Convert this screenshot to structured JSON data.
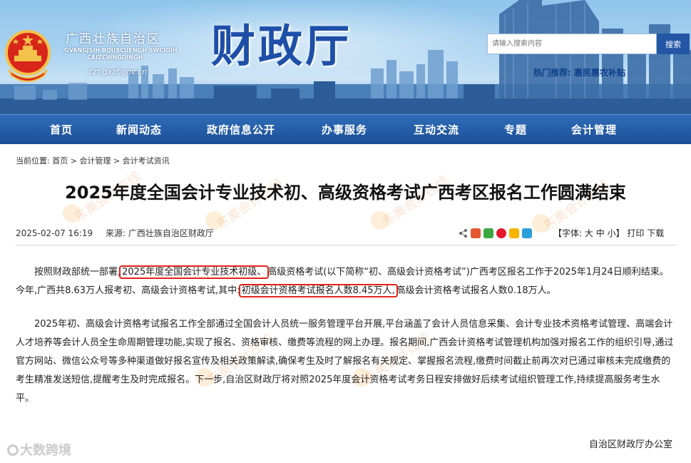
{
  "header": {
    "province_cn": "广西壮族自治区",
    "province_za": [
      "GVANGJSIH BOUXCUENGH SWCIGIH",
      "CAIZCWNGDINGH"
    ],
    "domain": "czt.gxzf.gov.cn",
    "title": "财政厅",
    "search": {
      "placeholder": "请输入搜索内容",
      "button": "搜索"
    },
    "hot": {
      "label": "热门推荐:",
      "item": "惠民惠农补贴"
    }
  },
  "nav": [
    "首页",
    "新闻动态",
    "政府信息公开",
    "办事服务",
    "互动交流",
    "专题",
    "会计管理"
  ],
  "breadcrumb": {
    "prefix": "当前位置:",
    "items": [
      "首页",
      "会计管理",
      "会计考试资讯"
    ],
    "sep": ">"
  },
  "article": {
    "title": "2025年度全国会计专业技术初、高级资格考试广西考区报名工作圆满结束",
    "date": "2025-02-07 16:19",
    "source": "来源: 广西壮族自治区财政厅",
    "options": {
      "font_label": "【字体:",
      "sizes": [
        "大",
        "中",
        "小"
      ],
      "close": "】",
      "print": "打印",
      "download": "下载"
    },
    "p1": {
      "a": "按照财政部统一部署,",
      "h1": "2025年度全国会计专业技术初级、",
      "b": "高级资格考试(以下简称“初、高级会计资格考试”)广西考区报名工作于2025年1月24日顺利结束。今年,广西共8.63万人报考初、高级会计资格考试,其中:",
      "h2": "初级会计资格考试报名人数8.45万人,",
      "c": "高级会计资格考试报名人数0.18万人。"
    },
    "p2": "2025年初、高级会计资格考试报名工作全部通过全国会计人员统一服务管理平台开展,平台涵盖了会计人员信息采集、会计专业技术资格考试管理、高端会计人才培养等会计人员全生命周期管理功能,实现了报名、资格审核、缴费等流程的网上办理。报名期间,广西会计资格考试管理机构加强对报名工作的组织引导,通过官方网站、微信公众号等多种渠道做好报名宣传及相关政策解读,确保考生及时了解报名有关规定、掌握报名流程,缴费时间截止前再次对已通过审核未完成缴费的考生精准发送短信,提醒考生及时完成报名。下一步,自治区财政厅将对照2025年度会计资格考试考务日程安排做好后续考试组织管理工作,持续提高服务考生水平。",
    "signature": "自治区财政厅办公室"
  },
  "share_icons": [
    "wechat-share-icon",
    "green-share-icon",
    "red-share-icon",
    "weibo-share-icon",
    "qzone-share-icon",
    "qq-share-icon"
  ],
  "watermark": "东奥会计在线",
  "corner_logo": "大数跨境",
  "colors": {
    "nav_bg": "#1d4f97",
    "title_blue": "#1e4fa8",
    "highlight": "#e2231a"
  }
}
